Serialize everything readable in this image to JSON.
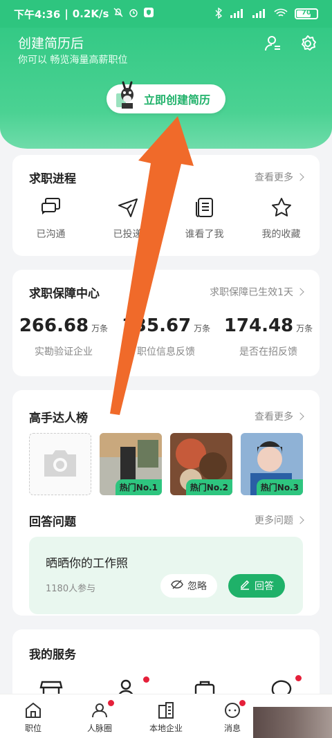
{
  "status_bar": {
    "time": "下午4:36",
    "speed": "0.2K/s",
    "battery": "70",
    "battery_level": 0.7
  },
  "header": {
    "title": "创建简历后",
    "subtitle": "你可以 畅览海量高薪职位",
    "create_button": "立即创建简历"
  },
  "progress": {
    "title": "求职进程",
    "more": "查看更多",
    "items": [
      {
        "label": "已沟通",
        "icon": "chat-icon"
      },
      {
        "label": "已投递",
        "icon": "send-icon"
      },
      {
        "label": "谁看了我",
        "icon": "document-icon"
      },
      {
        "label": "我的收藏",
        "icon": "star-icon"
      }
    ]
  },
  "guarantee": {
    "title": "求职保障中心",
    "more": "求职保障已生效1天",
    "stats": [
      {
        "value": "266.68",
        "unit": "万条",
        "label": "实勘验证企业"
      },
      {
        "value": "135.67",
        "unit": "万条",
        "label": "职位信息反馈"
      },
      {
        "value": "174.48",
        "unit": "万条",
        "label": "是否在招反馈"
      }
    ]
  },
  "masters": {
    "title": "高手达人榜",
    "more": "查看更多",
    "photos": [
      {
        "tag": "热门No.1",
        "color": "#8a8f7a"
      },
      {
        "tag": "热门No.2",
        "color": "#9a5a3a"
      },
      {
        "tag": "热门No.3",
        "color": "#4c7fb8"
      }
    ]
  },
  "questions": {
    "title": "回答问题",
    "more": "更多问题",
    "question": "晒晒你的工作照",
    "participants": "1180人参与",
    "ignore": "忽略",
    "answer": "回答"
  },
  "services": {
    "title": "我的服务"
  },
  "tabs": [
    {
      "label": "职位",
      "icon": "home-icon",
      "badge": false
    },
    {
      "label": "人脉圈",
      "icon": "people-icon",
      "badge": true
    },
    {
      "label": "本地企业",
      "icon": "building-icon",
      "badge": false
    },
    {
      "label": "消息",
      "icon": "message-icon",
      "badge": true
    }
  ],
  "colors": {
    "brand": "#2ec57f",
    "accent": "#1fb169",
    "arrow": "#f06a2a",
    "badge": "#e5203a"
  }
}
